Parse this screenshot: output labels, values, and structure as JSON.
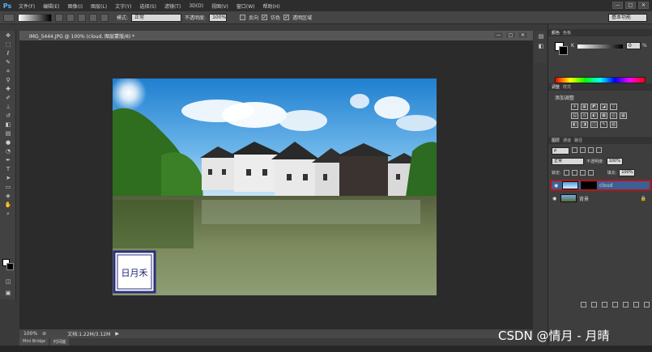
{
  "menubar": {
    "app_logo": "Ps",
    "items": [
      "文件(F)",
      "编辑(E)",
      "图像(I)",
      "图层(L)",
      "文字(Y)",
      "选择(S)",
      "滤镜(T)",
      "3D(D)",
      "视图(V)",
      "窗口(W)",
      "帮助(H)"
    ],
    "window_buttons": [
      "—",
      "□",
      "✕"
    ]
  },
  "options": {
    "mode_label": "模式:",
    "mode_value": "正常",
    "opacity_label": "不透明度:",
    "opacity_value": "100%",
    "reverse_label": "反向",
    "dither_label": "仿色",
    "transparency_label": "透明区域",
    "workspace": "基本功能"
  },
  "document": {
    "tab_title": "IMG_5444.JPG @ 100% (cloud, 图层蒙版/8) *",
    "zoom": "100%",
    "doc_info": "文档:1.22M/3.12M",
    "seal_text": "日月禾"
  },
  "bottom_tabs": [
    "Mini Bridge",
    "时间轴"
  ],
  "panels": {
    "color_tabs": [
      "颜色",
      "色板"
    ],
    "k_label": "K",
    "k_value": "0",
    "k_unit": "%",
    "adj_tabs": [
      "调整",
      "样式"
    ],
    "adj_title": "添加调整",
    "adj_icons": [
      "☀",
      "▦",
      "◩",
      "◪",
      "▽",
      "",
      "▤",
      "⚖",
      "◐",
      "▩",
      "◎",
      "▦",
      "◧",
      "◨",
      "◫",
      "✎",
      "▧",
      ""
    ],
    "layers_tabs": [
      "图层",
      "通道",
      "路径"
    ],
    "blend_mode": "正常",
    "opacity_label": "不透明度:",
    "opacity_value": "100%",
    "lock_label": "锁定:",
    "fill_label": "填充:",
    "fill_value": "100%",
    "layers": [
      {
        "name": "cloud",
        "selected": true
      },
      {
        "name": "背景",
        "selected": false
      }
    ]
  },
  "watermark": "CSDN @情月 - 月晴"
}
